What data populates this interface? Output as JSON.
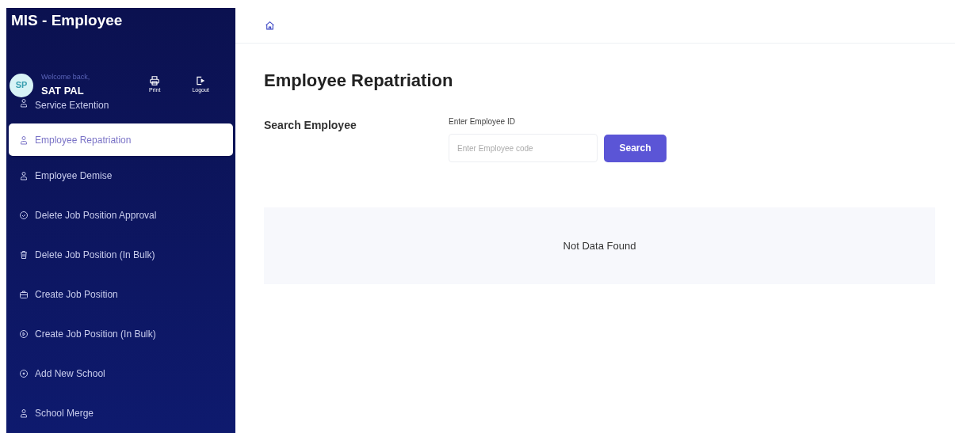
{
  "sidebar": {
    "title": "MIS - Employee",
    "user": {
      "initials": "SP",
      "greeting": "Welcome back,",
      "name": "SAT PAL"
    },
    "actions": [
      {
        "kind": "print",
        "label": "Print"
      },
      {
        "kind": "logout",
        "label": "Logout"
      }
    ],
    "items": [
      {
        "label": "Service Extention",
        "kind": "person",
        "selected": false
      },
      {
        "label": "Employee Repatriation",
        "kind": "person",
        "selected": true
      },
      {
        "label": "Employee Demise",
        "kind": "person",
        "selected": false
      },
      {
        "label": "Delete Job Position Approval",
        "kind": "check",
        "selected": false
      },
      {
        "label": "Delete Job Position (In Bulk)",
        "kind": "trash",
        "selected": false
      },
      {
        "label": "Create Job Position",
        "kind": "briefcase",
        "selected": false
      },
      {
        "label": "Create Job Position (In Bulk)",
        "kind": "play",
        "selected": false
      },
      {
        "label": "Add New School",
        "kind": "dot",
        "selected": false
      },
      {
        "label": "School Merge",
        "kind": "person",
        "selected": false
      }
    ]
  },
  "page": {
    "title": "Employee Repatriation",
    "section": "Search Employee",
    "field": {
      "label": "Enter Employee ID",
      "placeholder": "Enter Employee code"
    },
    "button": "Search",
    "empty_message": "Not Data Found"
  }
}
